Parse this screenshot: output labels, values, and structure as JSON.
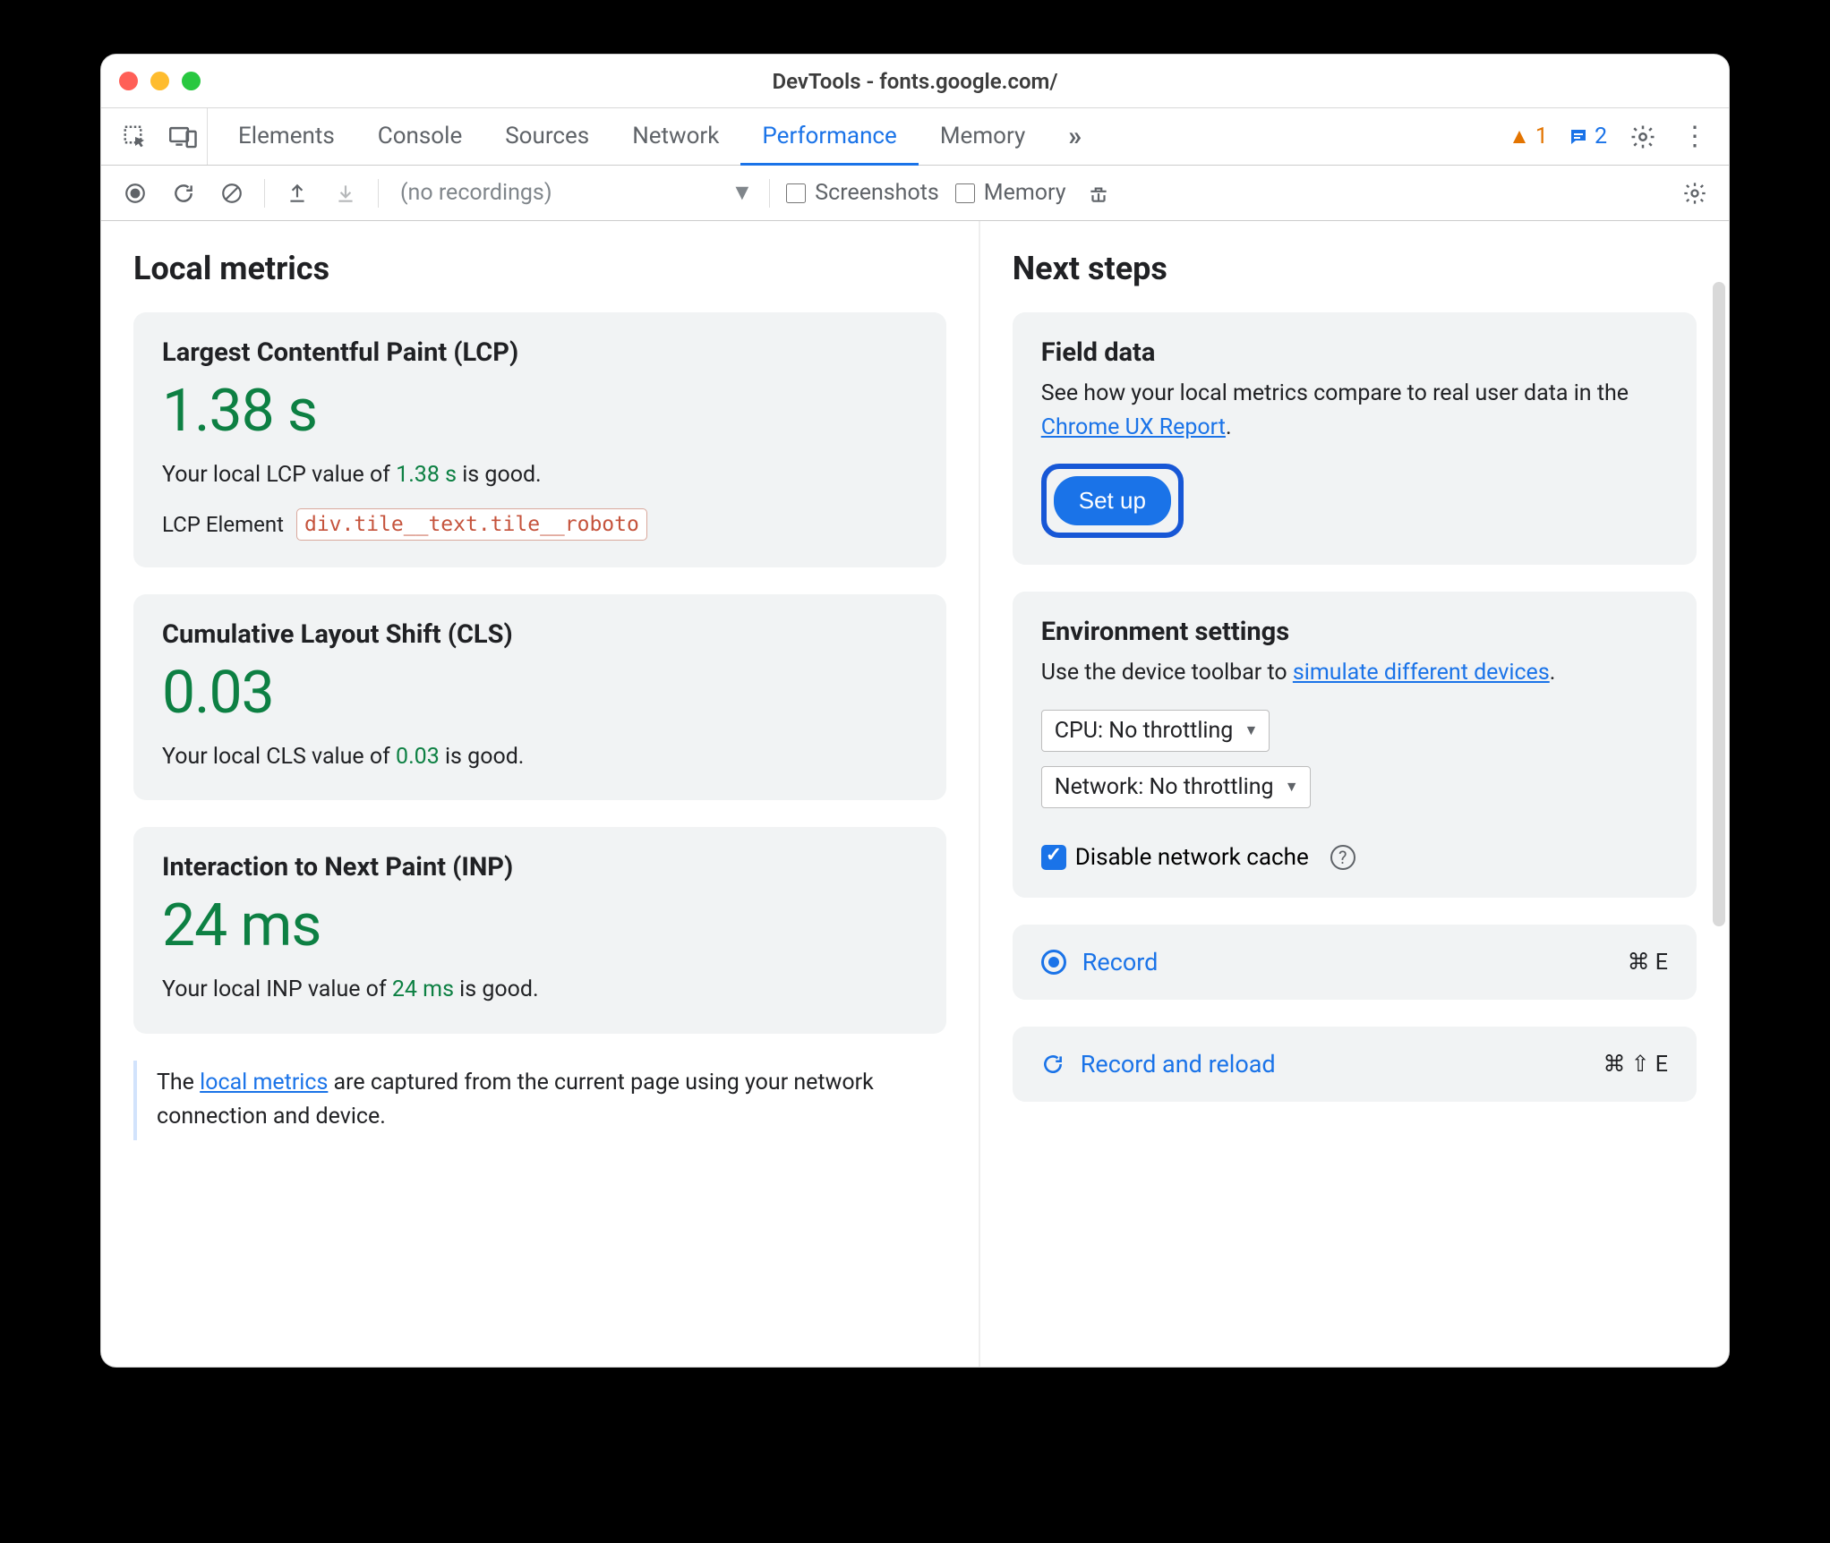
{
  "window": {
    "title": "DevTools - fonts.google.com/"
  },
  "tabs": {
    "items": [
      "Elements",
      "Console",
      "Sources",
      "Network",
      "Performance",
      "Memory"
    ],
    "active": "Performance"
  },
  "status": {
    "warnings": "1",
    "info": "2"
  },
  "toolbar2": {
    "no_recordings": "(no recordings)",
    "screenshots": "Screenshots",
    "memory": "Memory"
  },
  "left": {
    "heading": "Local metrics",
    "lcp": {
      "title": "Largest Contentful Paint (LCP)",
      "value": "1.38 s",
      "desc_pre": "Your local LCP value of ",
      "desc_val": "1.38 s",
      "desc_post": " is good.",
      "el_label": "LCP Element",
      "el_value": "div.tile__text.tile__roboto"
    },
    "cls": {
      "title": "Cumulative Layout Shift (CLS)",
      "value": "0.03",
      "desc_pre": "Your local CLS value of ",
      "desc_val": "0.03",
      "desc_post": " is good."
    },
    "inp": {
      "title": "Interaction to Next Paint (INP)",
      "value": "24 ms",
      "desc_pre": "Your local INP value of ",
      "desc_val": "24 ms",
      "desc_post": " is good."
    },
    "note_pre": "The ",
    "note_link": "local metrics",
    "note_post": " are captured from the current page using your network connection and device."
  },
  "right": {
    "heading": "Next steps",
    "field": {
      "title": "Field data",
      "desc_pre": "See how your local metrics compare to real user data in the ",
      "link": "Chrome UX Report",
      "desc_post": ".",
      "button": "Set up"
    },
    "env": {
      "title": "Environment settings",
      "desc_pre": "Use the device toolbar to ",
      "link": "simulate different devices",
      "desc_post": ".",
      "cpu": "CPU: No throttling",
      "network": "Network: No throttling",
      "disable_cache": "Disable network cache"
    },
    "record": {
      "label": "Record",
      "shortcut": "⌘ E"
    },
    "record_reload": {
      "label": "Record and reload",
      "shortcut": "⌘ ⇧ E"
    }
  }
}
